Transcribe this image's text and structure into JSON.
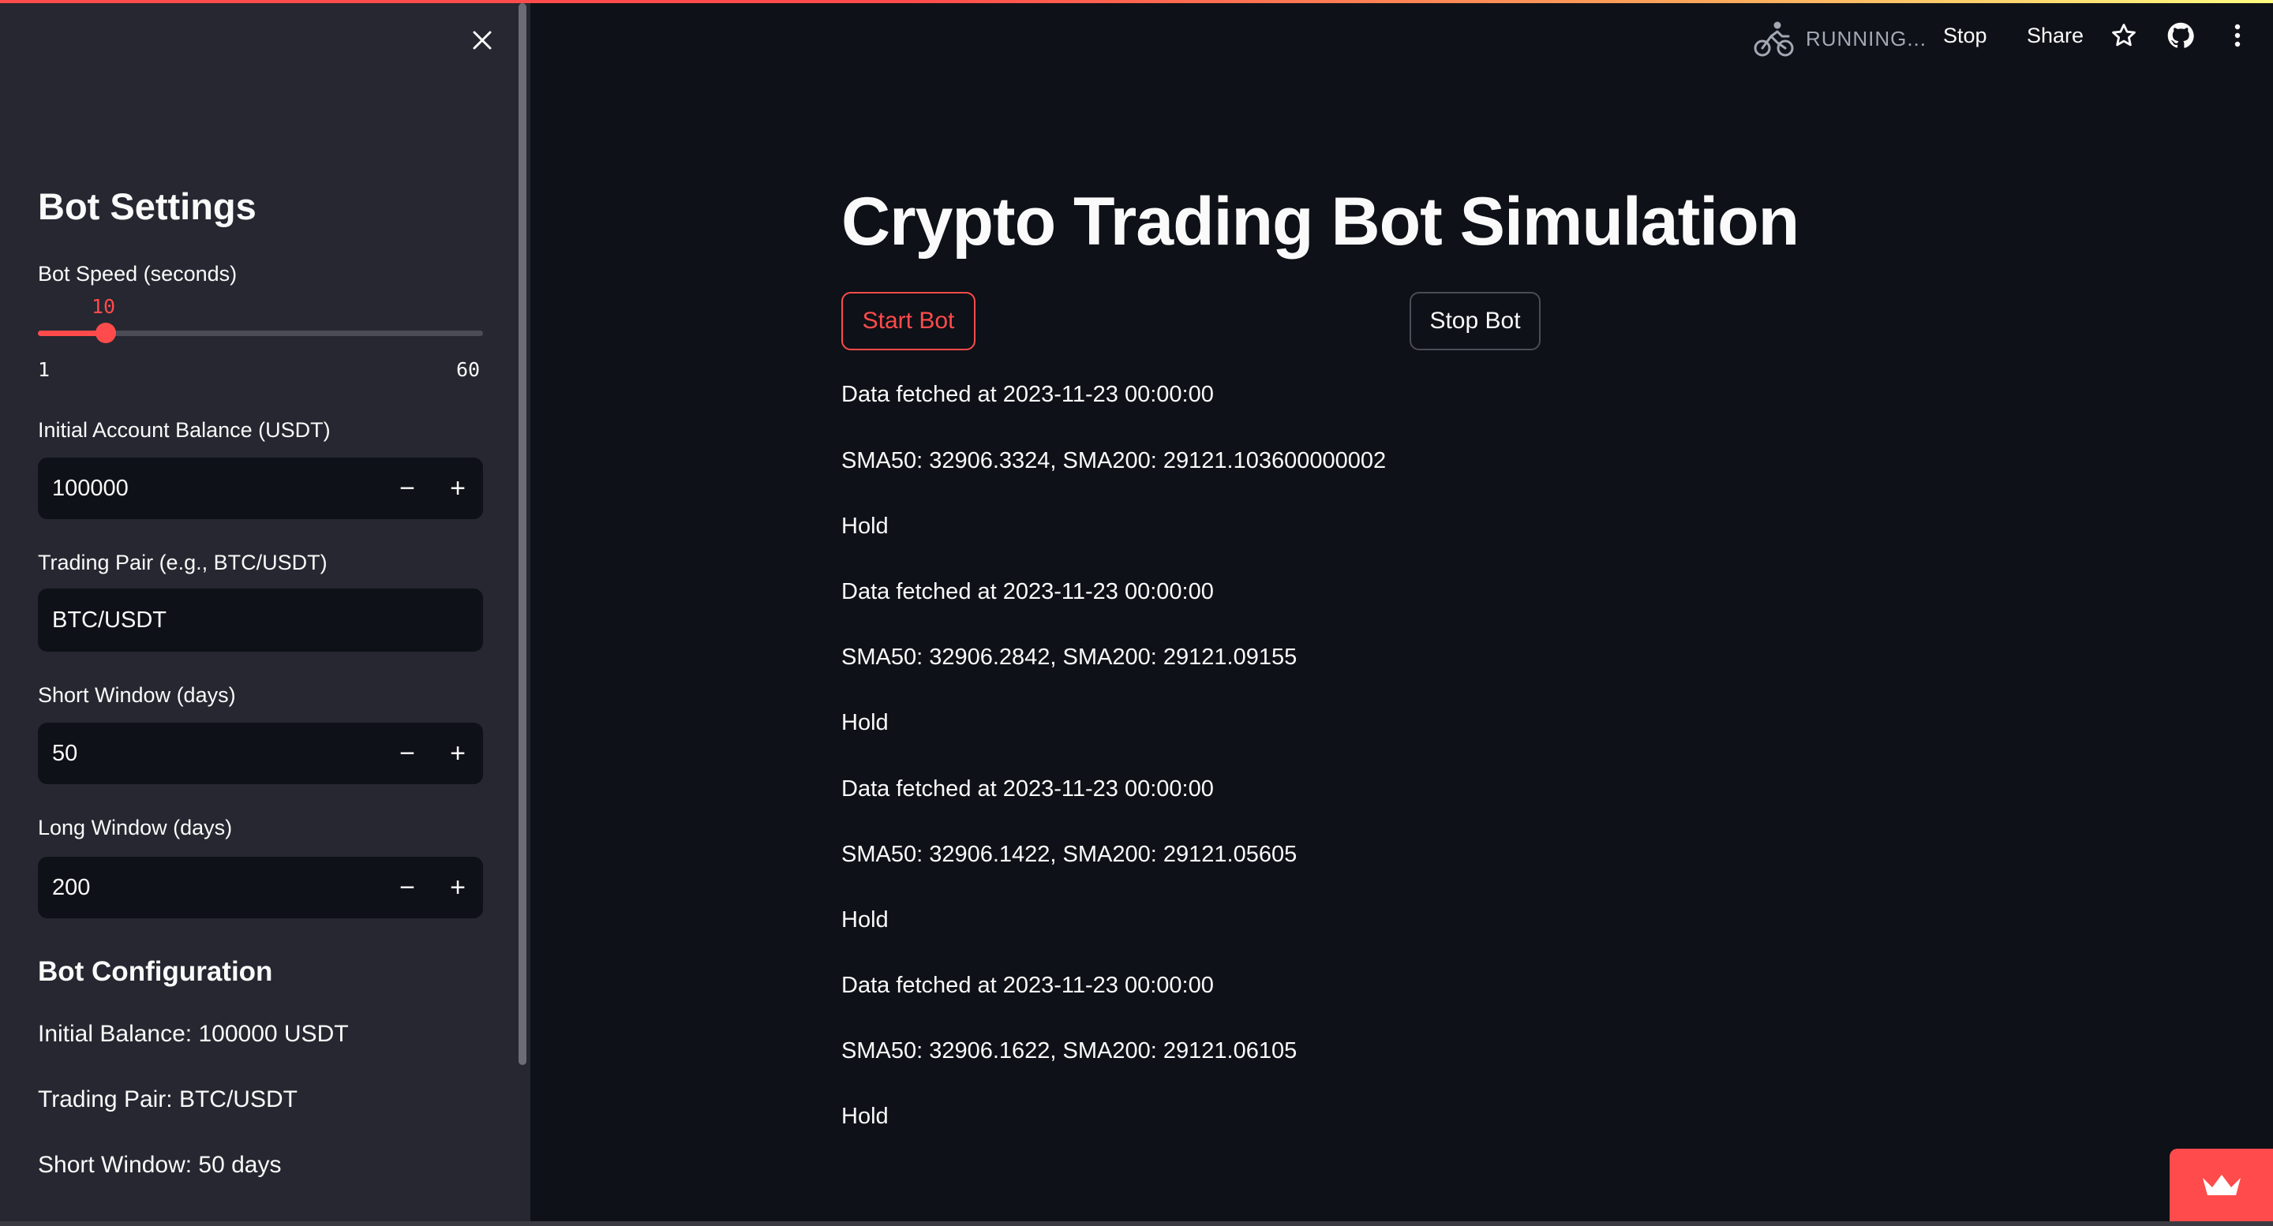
{
  "header": {
    "status": "RUNNING...",
    "stop_label": "Stop",
    "share_label": "Share",
    "icons": [
      "running-man-icon",
      "star-icon",
      "github-icon",
      "more-vert-icon"
    ]
  },
  "sidebar": {
    "heading": "Bot Settings",
    "speed": {
      "label": "Bot Speed (seconds)",
      "value": "10",
      "min": "1",
      "max": "60",
      "fraction": 0.1525
    },
    "balance": {
      "label": "Initial Account Balance (USDT)",
      "value": "100000"
    },
    "pair": {
      "label": "Trading Pair (e.g., BTC/USDT)",
      "value": "BTC/USDT"
    },
    "short_window": {
      "label": "Short Window (days)",
      "value": "50"
    },
    "long_window": {
      "label": "Long Window (days)",
      "value": "200"
    },
    "config": {
      "heading": "Bot Configuration",
      "lines": [
        "Initial Balance: 100000 USDT",
        "Trading Pair: BTC/USDT",
        "Short Window: 50 days"
      ]
    },
    "stepper": {
      "minus": "−",
      "plus": "+"
    }
  },
  "main": {
    "title": "Crypto Trading Bot Simulation",
    "start_label": "Start Bot",
    "stop_label": "Stop Bot",
    "log": [
      "Data fetched at 2023-11-23 00:00:00",
      "SMA50: 32906.3324, SMA200: 29121.103600000002",
      "Hold",
      "Data fetched at 2023-11-23 00:00:00",
      "SMA50: 32906.2842, SMA200: 29121.09155",
      "Hold",
      "Data fetched at 2023-11-23 00:00:00",
      "SMA50: 32906.1422, SMA200: 29121.05605",
      "Hold",
      "Data fetched at 2023-11-23 00:00:00",
      "SMA50: 32906.1622, SMA200: 29121.06105",
      "Hold"
    ]
  },
  "colors": {
    "accent": "#ff4b4b",
    "background": "#0e1117",
    "sidebar": "#262730"
  }
}
